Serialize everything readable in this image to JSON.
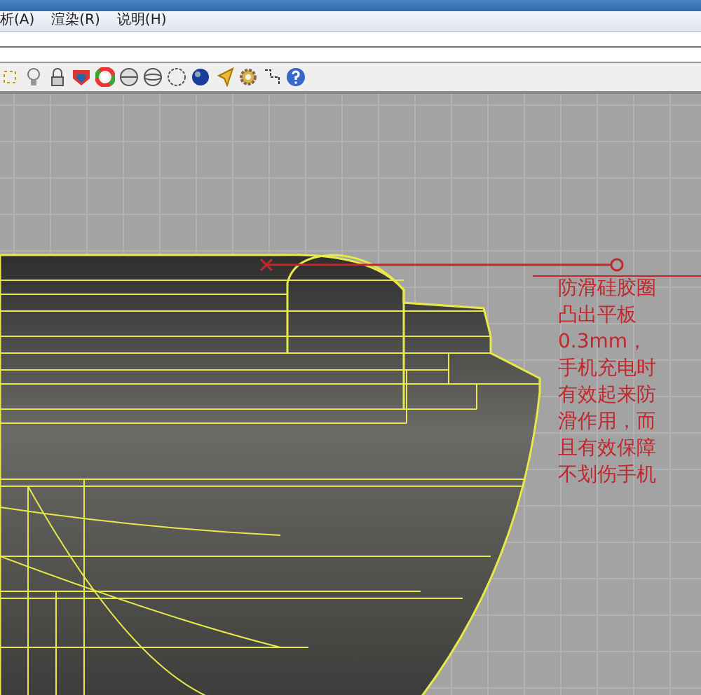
{
  "menu_bar": {
    "items": [
      "析(A)",
      "渲染(R)",
      "说明(H)"
    ]
  },
  "viewport": {
    "annotation": "防滑硅胶圈凸出平板0.3mm，手机充电时有效起来防滑作用，而且有效保障不划伤手机"
  }
}
